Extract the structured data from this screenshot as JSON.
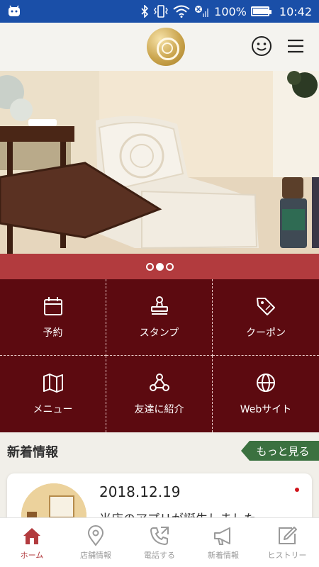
{
  "status_bar": {
    "battery_percent": "100%",
    "time": "10:42",
    "battery_level": 1.0,
    "icons": [
      "android-notification-icon",
      "bluetooth-icon",
      "vibrate-icon",
      "wifi-icon",
      "no-signal-icon",
      "battery-icon"
    ]
  },
  "header": {
    "logo": "rose-logo",
    "icons": [
      "smiley-icon",
      "hamburger-menu-icon"
    ]
  },
  "carousel": {
    "slide_count": 3,
    "active_index": 1
  },
  "menu_grid": [
    {
      "label": "予約",
      "icon": "calendar-icon"
    },
    {
      "label": "スタンプ",
      "icon": "stamp-icon"
    },
    {
      "label": "クーポン",
      "icon": "tag-icon"
    },
    {
      "label": "メニュー",
      "icon": "map-icon"
    },
    {
      "label": "友達に紹介",
      "icon": "share-icon"
    },
    {
      "label": "Webサイト",
      "icon": "globe-icon"
    }
  ],
  "news": {
    "title": "新着情報",
    "more_label": "もっと見る",
    "items": [
      {
        "date": "2018.12.19",
        "text": "当店のアプリが誕生しました"
      }
    ]
  },
  "bottom_nav": [
    {
      "label": "ホーム",
      "icon": "home-icon",
      "active": true
    },
    {
      "label": "店舗情報",
      "icon": "location-pin-icon",
      "active": false
    },
    {
      "label": "電話する",
      "icon": "phone-icon",
      "active": false
    },
    {
      "label": "新着情報",
      "icon": "megaphone-icon",
      "active": false
    },
    {
      "label": "ヒストリー",
      "icon": "edit-icon",
      "active": false
    }
  ],
  "colors": {
    "status_bar": "#1a4fa8",
    "grid_bg": "#5c0a10",
    "accent_red": "#b23b3e",
    "more_button": "#3b7140",
    "gold": "#caa44d"
  }
}
